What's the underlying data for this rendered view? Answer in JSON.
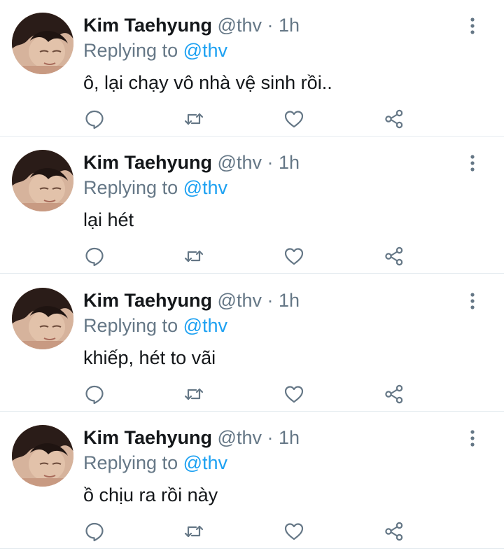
{
  "tweets": [
    {
      "name": "Kim Taehyung",
      "handle": "@thv",
      "dot": "·",
      "time": "1h",
      "replying_prefix": "Replying to",
      "replying_handle": "@thv",
      "text": "ô, lại chạy vô nhà vệ sinh rồi.."
    },
    {
      "name": "Kim Taehyung",
      "handle": "@thv",
      "dot": "·",
      "time": "1h",
      "replying_prefix": "Replying to",
      "replying_handle": "@thv",
      "text": "lại hét"
    },
    {
      "name": "Kim Taehyung",
      "handle": "@thv",
      "dot": "·",
      "time": "1h",
      "replying_prefix": "Replying to",
      "replying_handle": "@thv",
      "text": "khiếp, hét to vãi"
    },
    {
      "name": "Kim Taehyung",
      "handle": "@thv",
      "dot": "·",
      "time": "1h",
      "replying_prefix": "Replying to",
      "replying_handle": "@thv",
      "text": "ồ chịu ra rồi này"
    }
  ],
  "icons": {
    "more": "more-vertical-icon",
    "reply": "reply-icon",
    "retweet": "retweet-icon",
    "like": "heart-icon",
    "share": "share-icon"
  },
  "colors": {
    "name": "#14171a",
    "secondary": "#657786",
    "link": "#1da1f2",
    "divider": "#e6ecf0"
  }
}
